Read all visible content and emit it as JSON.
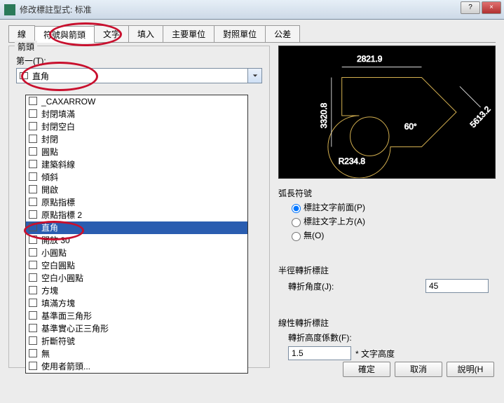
{
  "window": {
    "title": "修改標註型式: 标准"
  },
  "tabs": {
    "line": "線",
    "symbols_arrows": "符號與箭頭",
    "text": "文字",
    "fill": "填入",
    "primary_units": "主要單位",
    "alt_units": "對照單位",
    "tolerance": "公差"
  },
  "arrows": {
    "group_label": "箭頭",
    "first_label": "第一(T):",
    "first_value": "直角",
    "options": [
      "_CAXARROW",
      "封閉填滿",
      "封閉空白",
      "封閉",
      "圓點",
      "建築斜線",
      "傾斜",
      "開啟",
      "原點指標",
      "原點指標 2",
      "直角",
      "開放 30",
      "小圓點",
      "空白圓點",
      "空白小圓點",
      "方塊",
      "填滿方塊",
      "基準面三角形",
      "基準實心正三角形",
      "折斷符號",
      "無",
      "使用者箭頭..."
    ],
    "selected_index": 10
  },
  "arc_length": {
    "group_label": "弧長符號",
    "opt_before": "標註文字前面(P)",
    "opt_above": "標註文字上方(A)",
    "opt_none": "無(O)"
  },
  "radius_jog": {
    "group_label": "半徑轉折標註",
    "angle_label": "轉折角度(J):",
    "angle_value": "45"
  },
  "linear_jog": {
    "group_label": "線性轉折標註",
    "factor_label": "轉折高度係數(F):",
    "factor_value": "1.5",
    "suffix": "* 文字高度"
  },
  "preview": {
    "dim_top": "2821.9",
    "dim_left": "3320.8",
    "dim_diag": "5613.2",
    "dim_radius": "R234.8",
    "dim_angle": "60°"
  },
  "buttons": {
    "ok": "確定",
    "cancel": "取消",
    "help": "說明(H"
  }
}
